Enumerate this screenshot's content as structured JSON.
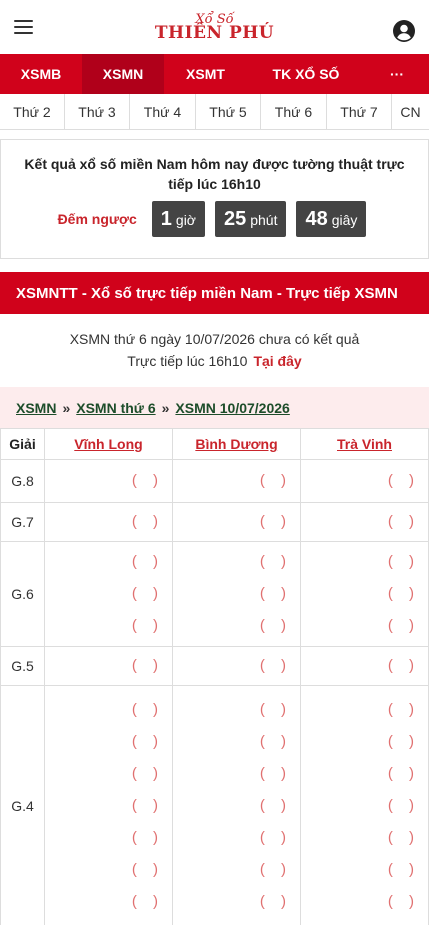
{
  "header": {
    "logo_script": "Xổ Số",
    "logo_brand": "THIÊN PHÚ"
  },
  "main_nav": [
    {
      "label": "XSMB",
      "active": false
    },
    {
      "label": "XSMN",
      "active": true
    },
    {
      "label": "XSMT",
      "active": false
    },
    {
      "label": "TK XỔ SỐ",
      "active": false
    },
    {
      "label": "···",
      "active": false
    }
  ],
  "day_nav": [
    "Thứ 2",
    "Thứ 3",
    "Thứ 4",
    "Thứ 5",
    "Thứ 6",
    "Thứ 7",
    "CN"
  ],
  "countdown": {
    "headline": "Kết quả xổ số miền Nam hôm nay được tường thuật trực tiếp lúc 16h10",
    "label": "Đếm ngược",
    "hours": "1",
    "hours_unit": "giờ",
    "minutes": "25",
    "minutes_unit": "phút",
    "seconds": "48",
    "seconds_unit": "giây"
  },
  "live_bar": {
    "title": "XSMNTT - Xổ số trực tiếp miền Nam - Trực tiếp XSMN"
  },
  "notice": {
    "line1": "XSMN thứ 6 ngày 10/07/2026 chưa có kết quả",
    "line2": "Trực tiếp lúc 16h10",
    "link": "Tại đây"
  },
  "breadcrumb": [
    {
      "label": "XSMN"
    },
    {
      "label": "XSMN thứ 6"
    },
    {
      "label": "XSMN 10/07/2026"
    }
  ],
  "breadcrumb_sep": "»",
  "results": {
    "prize_header": "Giải",
    "provinces": [
      "Vĩnh Long",
      "Bình Dương",
      "Trà Vinh"
    ],
    "placeholder": "( )",
    "rows": [
      {
        "prize": "G.8",
        "count": 1
      },
      {
        "prize": "G.7",
        "count": 1
      },
      {
        "prize": "G.6",
        "count": 3
      },
      {
        "prize": "G.5",
        "count": 1
      },
      {
        "prize": "G.4",
        "count": 7
      }
    ]
  }
}
